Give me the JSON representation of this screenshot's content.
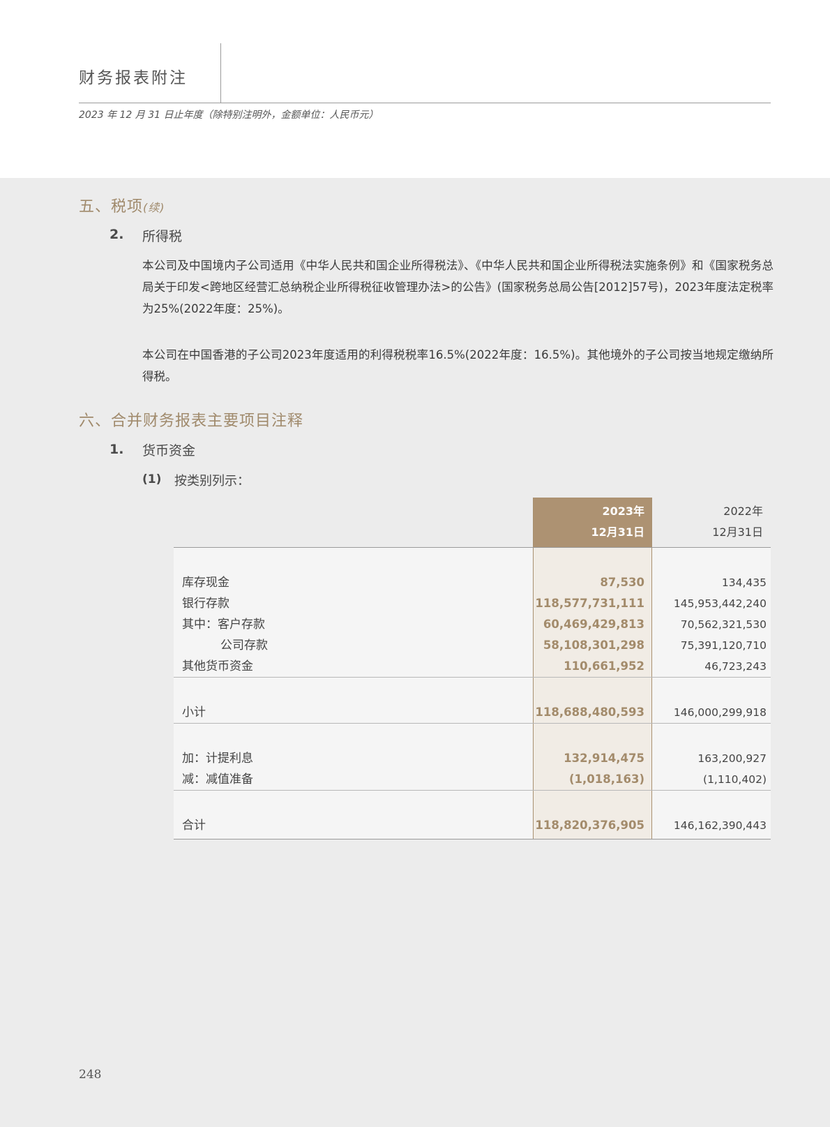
{
  "header": {
    "title": "财务报表附注",
    "subtitle": "2023 年 12 月 31 日止年度（除特别注明外，金额单位：人民币元）"
  },
  "section5": {
    "title": "五、税项",
    "cont": "(续)",
    "sub": {
      "num": "2.",
      "title": "所得税",
      "para1": "本公司及中国境内子公司适用《中华人民共和国企业所得税法》、《中华人民共和国企业所得税法实施条例》和《国家税务总局关于印发<跨地区经营汇总纳税企业所得税征收管理办法>的公告》(国家税务总局公告[2012]57号)，2023年度法定税率为25%(2022年度：25%)。",
      "para2": "本公司在中国香港的子公司2023年度适用的利得税税率16.5%(2022年度：16.5%)。其他境外的子公司按当地规定缴纳所得税。"
    }
  },
  "section6": {
    "title": "六、合并财务报表主要项目注释",
    "sub": {
      "num": "1.",
      "title": "货币资金",
      "item_num": "(1)",
      "item_title": "按类别列示："
    }
  },
  "table": {
    "header_2023": [
      "2023年",
      "12月31日"
    ],
    "header_2022": [
      "2022年",
      "12月31日"
    ],
    "rows": [
      {
        "label": "库存现金",
        "v2023": "87,530",
        "v2022": "134,435"
      },
      {
        "label": "银行存款",
        "v2023": "118,577,731,111",
        "v2022": "145,953,442,240"
      },
      {
        "label": "其中：客户存款",
        "v2023": "60,469,429,813",
        "v2022": "70,562,321,530"
      },
      {
        "label": "公司存款",
        "v2023": "58,108,301,298",
        "v2022": "75,391,120,710"
      },
      {
        "label": "其他货币资金",
        "v2023": "110,661,952",
        "v2022": "46,723,243"
      },
      {
        "label": "小计",
        "v2023": "118,688,480,593",
        "v2022": "146,000,299,918"
      },
      {
        "label": "加：计提利息",
        "v2023": "132,914,475",
        "v2022": "163,200,927"
      },
      {
        "label": "减：减值准备",
        "v2023": "(1,018,163)",
        "v2022": "(1,110,402)"
      },
      {
        "label": "合计",
        "v2023": "118,820,376,905",
        "v2022": "146,162,390,443"
      }
    ]
  },
  "footer": {
    "page_number": "248"
  },
  "colors": {
    "accent": "#ad9272",
    "accent_text": "#a38b6b",
    "section_title": "#a08a6c",
    "background": "#ececec"
  }
}
